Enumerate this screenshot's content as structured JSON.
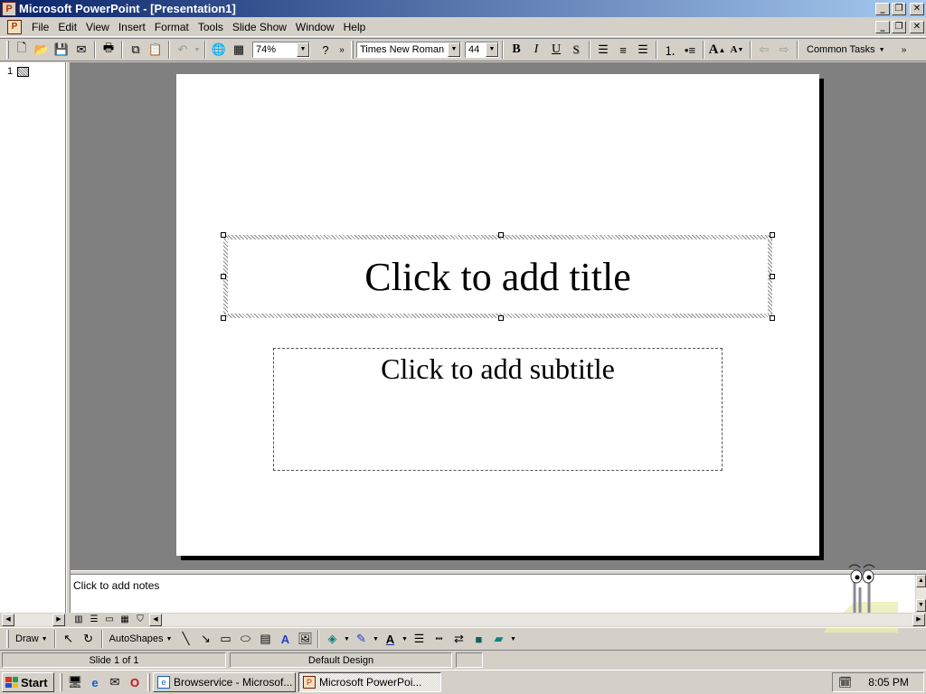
{
  "window": {
    "title": "Microsoft PowerPoint - [Presentation1]",
    "controls": [
      "minimize",
      "restore",
      "close"
    ]
  },
  "menubar": {
    "items": [
      "File",
      "Edit",
      "View",
      "Insert",
      "Format",
      "Tools",
      "Slide Show",
      "Window",
      "Help"
    ]
  },
  "toolbar": {
    "zoom": "74%",
    "font_name": "Times New Roman",
    "font_size": "44",
    "bold": "B",
    "italic": "I",
    "underline": "U",
    "shadow": "S",
    "common_tasks": "Common Tasks"
  },
  "outline": {
    "slide_number": "1"
  },
  "slide": {
    "title_placeholder": "Click to add title",
    "subtitle_placeholder": "Click to add subtitle"
  },
  "notes": {
    "placeholder": "Click to add notes"
  },
  "drawing_toolbar": {
    "draw_label": "Draw",
    "autoshapes_label": "AutoShapes"
  },
  "statusbar": {
    "slide_info": "Slide 1 of 1",
    "design": "Default Design"
  },
  "taskbar": {
    "start_label": "Start",
    "tasks": [
      "Browservice - Microsof...",
      "Microsoft PowerPoi..."
    ],
    "clock": "8:05 PM"
  },
  "colors": {
    "titlebar_start": "#0a246a",
    "titlebar_end": "#a6caf0",
    "workspace": "#808080",
    "chrome": "#d4d0c8"
  },
  "icons": {
    "toolbar": [
      "new-icon",
      "open-icon",
      "save-icon",
      "email-icon",
      "print-icon",
      "copy-icon",
      "paste-icon",
      "undo-icon",
      "hyperlink-icon",
      "tables-icon",
      "help-icon"
    ],
    "drawing": [
      "select-pointer-icon",
      "free-rotate-icon",
      "line-icon",
      "arrow-icon",
      "rectangle-icon",
      "oval-icon",
      "text-box-icon",
      "wordart-icon",
      "clip-art-icon",
      "fill-color-icon",
      "line-color-icon",
      "font-color-icon",
      "line-style-icon",
      "dash-style-icon",
      "arrow-style-icon",
      "shadow-icon",
      "3d-icon"
    ]
  }
}
